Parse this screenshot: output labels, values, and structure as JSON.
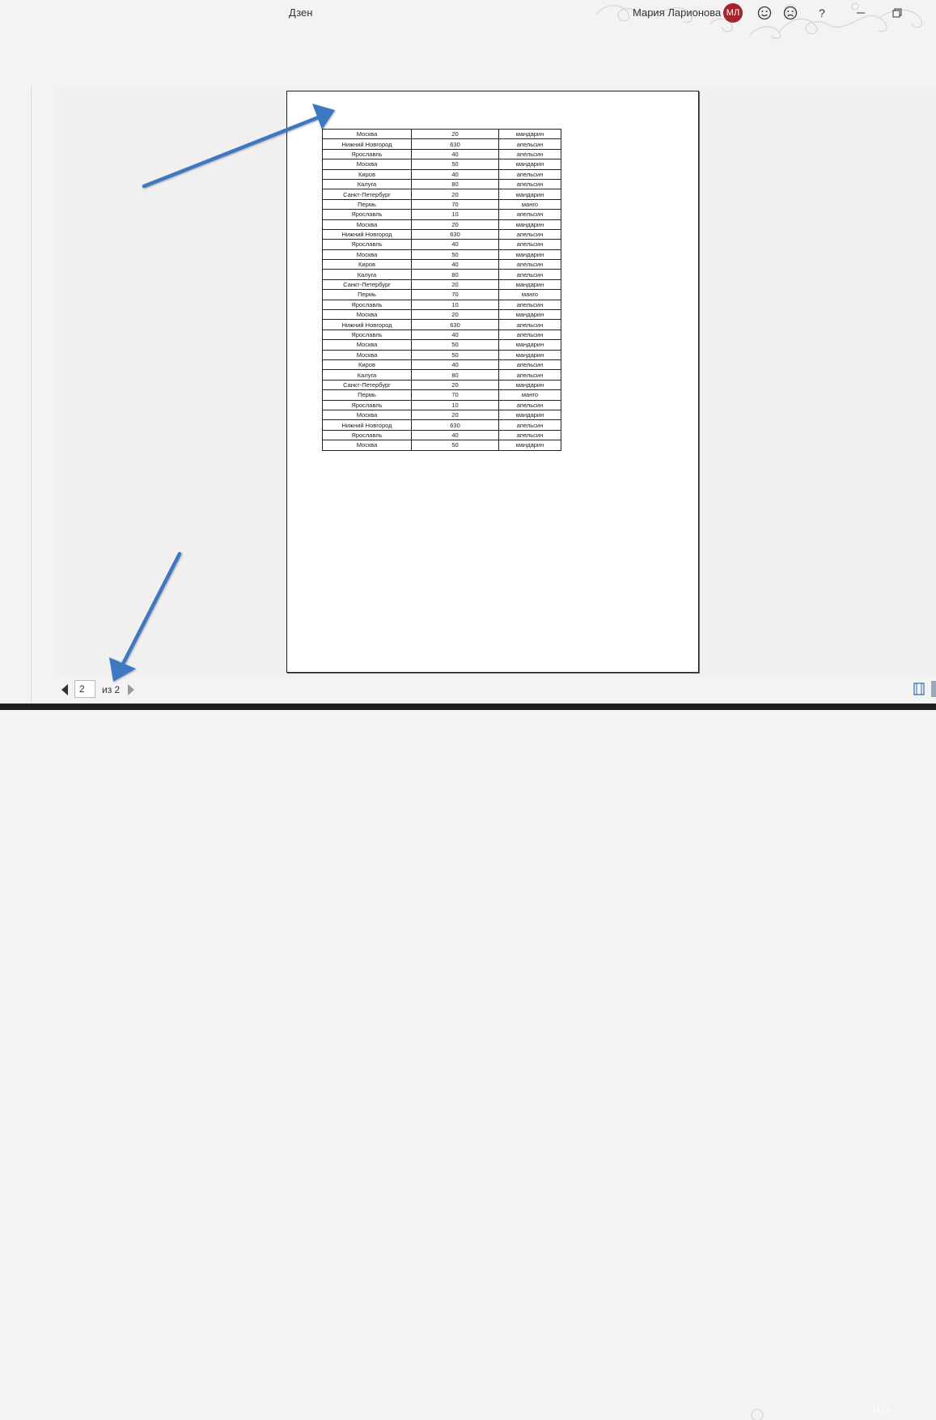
{
  "window": {
    "doc_title": "Дзен",
    "user_name": "Мария Ларионова",
    "user_initials": "МЛ",
    "buttons": {
      "smile": "smile-icon",
      "frown": "frown-icon",
      "help": "?",
      "minimize": "minimize-icon",
      "restore": "restore-icon"
    },
    "accent": "#a4262c"
  },
  "table": {
    "rows": [
      [
        "Москва",
        "20",
        "мандарин"
      ],
      [
        "Нижний Новгород",
        "630",
        "апельсин"
      ],
      [
        "Ярославль",
        "40",
        "апельсин"
      ],
      [
        "Москва",
        "50",
        "мандарин"
      ],
      [
        "Киров",
        "40",
        "апельсин"
      ],
      [
        "Калуга",
        "80",
        "апельсин"
      ],
      [
        "Санкт-Петербург",
        "20",
        "мандарин"
      ],
      [
        "Пермь",
        "70",
        "манго"
      ],
      [
        "Ярославль",
        "10",
        "апельсин"
      ],
      [
        "Москва",
        "20",
        "мандарин"
      ],
      [
        "Нижний Новгород",
        "630",
        "апельсин"
      ],
      [
        "Ярославль",
        "40",
        "апельсин"
      ],
      [
        "Москва",
        "50",
        "мандарин"
      ],
      [
        "Киров",
        "40",
        "апельсин"
      ],
      [
        "Калуга",
        "80",
        "апельсин"
      ],
      [
        "Санкт-Петербург",
        "20",
        "мандарин"
      ],
      [
        "Пермь",
        "70",
        "манго"
      ],
      [
        "Ярославль",
        "10",
        "апельсин"
      ],
      [
        "Москва",
        "20",
        "мандарин"
      ],
      [
        "Нижний Новгород",
        "630",
        "апельсин"
      ],
      [
        "Ярославль",
        "40",
        "апельсин"
      ],
      [
        "Москва",
        "50",
        "мандарин"
      ],
      [
        "Москва",
        "50",
        "мандарин"
      ],
      [
        "Киров",
        "40",
        "апельсин"
      ],
      [
        "Калуга",
        "80",
        "апельсин"
      ],
      [
        "Санкт-Петербург",
        "20",
        "мандарин"
      ],
      [
        "Пермь",
        "70",
        "манго"
      ],
      [
        "Ярославль",
        "10",
        "апельсин"
      ],
      [
        "Москва",
        "20",
        "мандарин"
      ],
      [
        "Нижний Новгород",
        "630",
        "апельсин"
      ],
      [
        "Ярославль",
        "40",
        "апельсин"
      ],
      [
        "Москва",
        "50",
        "мандарин"
      ]
    ]
  },
  "navigation": {
    "current_page": "2",
    "of_label": "из 2"
  },
  "taskbar": {
    "time": "14:58"
  },
  "annotations": {
    "arrow_color": "#3d78c0"
  }
}
